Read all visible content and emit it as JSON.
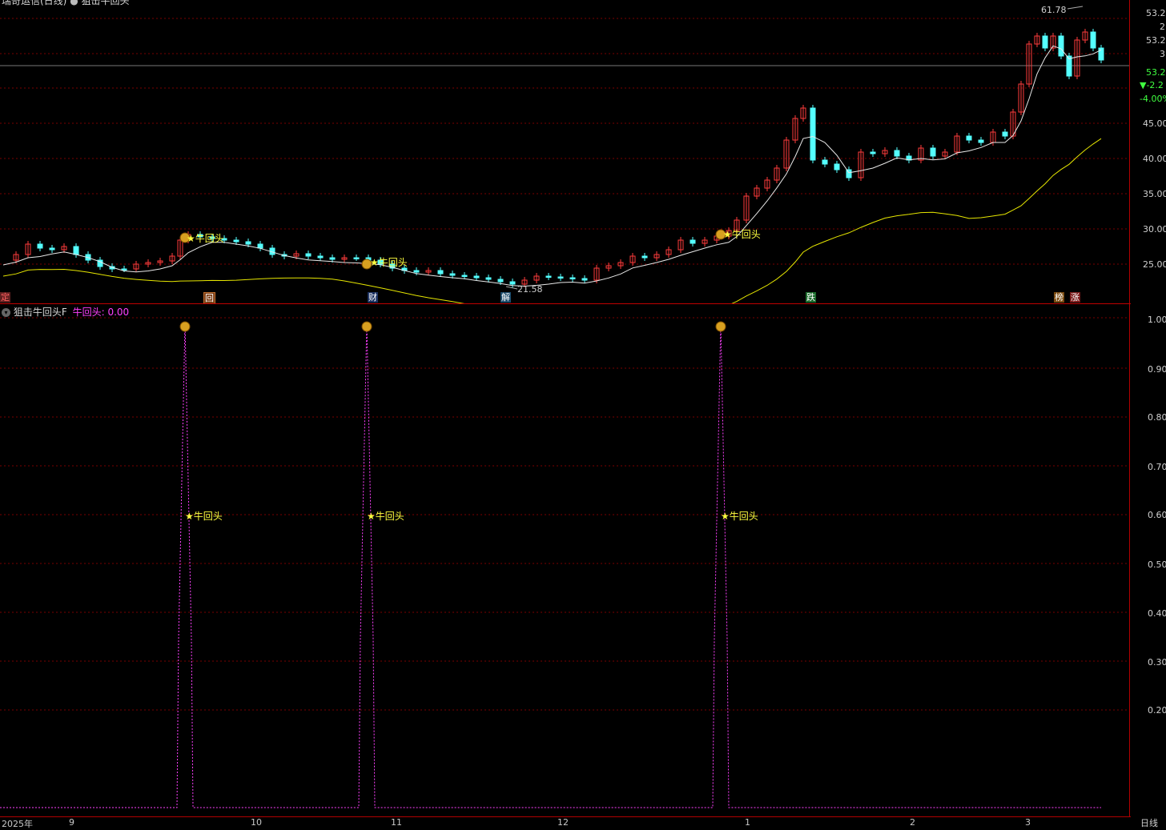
{
  "header": {
    "title_left": "瑞奇运信(日线)",
    "title_right": "狙击牛回头",
    "collapse_icon": "chevron-circle-icon"
  },
  "indicator_header": {
    "name": "狙击牛回头F",
    "series_label": "牛回头:",
    "series_value": "0.00"
  },
  "price_axis": {
    "labels": [
      "53.2",
      "2",
      "53.2",
      "3",
      "45.00",
      "40.00",
      "35.00",
      "30.00",
      "25.00"
    ],
    "current_price": "53.2",
    "change": "▼-2.2",
    "change_pct": "-4.00%"
  },
  "price_annotations": {
    "high": "61.78",
    "low": "21.58",
    "signal_label": "★牛回头"
  },
  "event_tags": [
    {
      "text": "定",
      "color": "#ff6060"
    },
    {
      "text": "回",
      "color": "#ffffff"
    },
    {
      "text": "财",
      "color": "#ffffff"
    },
    {
      "text": "解",
      "color": "#ffffff"
    },
    {
      "text": "跌",
      "color": "#ffffff"
    },
    {
      "text": "榜",
      "color": "#ffffff"
    },
    {
      "text": "涨",
      "color": "#ffffff"
    }
  ],
  "indicator_axis": {
    "labels": [
      "1.00",
      "0.90",
      "0.80",
      "0.70",
      "0.60",
      "0.50",
      "0.40",
      "0.30",
      "0.20"
    ]
  },
  "time_axis": {
    "labels": [
      "2025年",
      "9",
      "10",
      "11",
      "12",
      "1",
      "2",
      "3"
    ]
  },
  "period_label": "日线",
  "colors": {
    "up": "#ff3c3c",
    "down": "#54ffff",
    "ma_short": "#e8e8e8",
    "ma_long": "#e6e600",
    "signal": "#ff40ff",
    "grid": "#7a0000"
  }
}
